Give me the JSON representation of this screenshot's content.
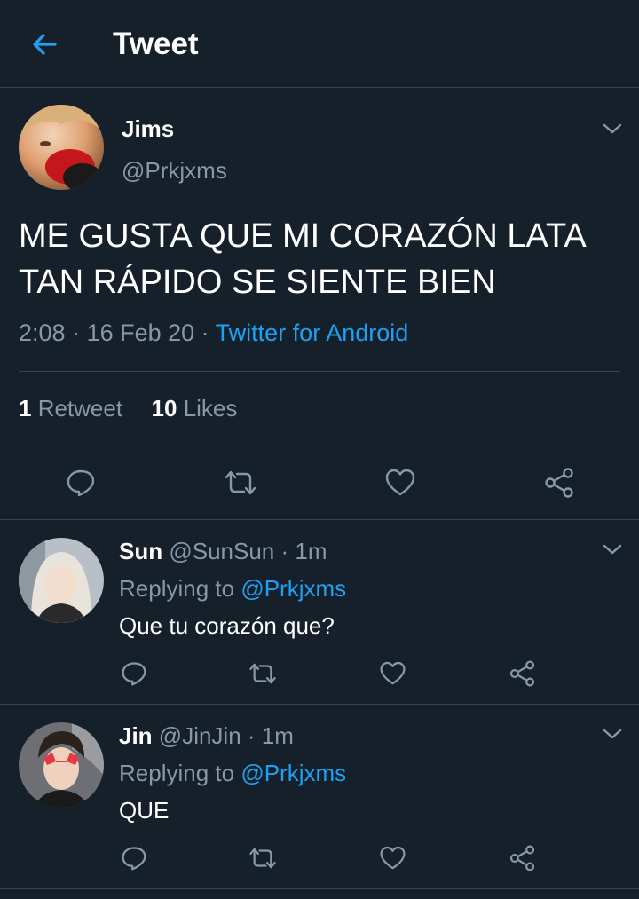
{
  "header": {
    "title": "Tweet"
  },
  "tweet": {
    "name": "Jims",
    "handle": "@Prkjxms",
    "text_line1": "ME GUSTA QUE MI CORAZÓN LATA",
    "text_line2": "TAN RÁPIDO SE SIENTE BIEN",
    "time": "2:08",
    "sep1": " · ",
    "date": "16 Feb 20",
    "sep2": " · ",
    "source": "Twitter for Android",
    "retweet_count": "1",
    "retweet_label": " Retweet",
    "like_count": "10",
    "like_label": " Likes"
  },
  "replies": [
    {
      "name": "Sun",
      "handle": " @SunSun",
      "time": " · 1m",
      "replying_label": "Replying to ",
      "replying_to": "@Prkjxms",
      "text": "Que tu corazón que?"
    },
    {
      "name": "Jin",
      "handle": " @JinJin",
      "time": " · 1m",
      "replying_label": "Replying to ",
      "replying_to": "@Prkjxms",
      "text": "QUE"
    }
  ],
  "icons": {
    "back": "arrow-left-icon",
    "menu": "chevron-down-icon",
    "reply": "speech-bubble-icon",
    "retweet": "retweet-icon",
    "like": "heart-icon",
    "share": "share-icon"
  },
  "colors": {
    "background": "#15202b",
    "accent": "#1da1f2",
    "muted": "#8899a6",
    "divider": "#38444d"
  }
}
